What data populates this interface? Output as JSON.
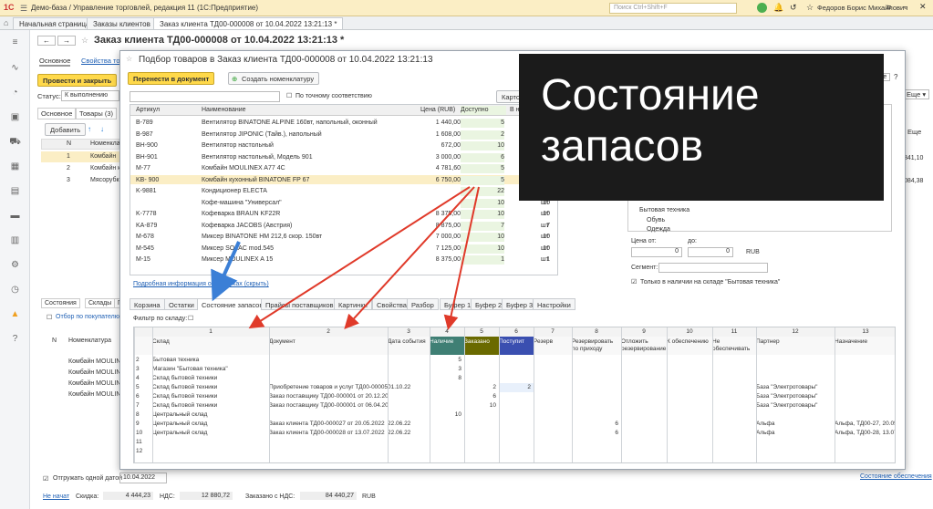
{
  "app": {
    "title": "Демо-база / Управление торговлей, редакция 11  (1С:Предприятие)",
    "search_placeholder": "Поиск Ctrl+Shift+F",
    "user": "Федоров Борис Михайлович"
  },
  "tabs": [
    "Начальная страница",
    "Заказы клиентов",
    "Заказ клиента ТД00-000008 от 10.04.2022 13:21:13 *"
  ],
  "doc": {
    "title": "Заказ клиента ТД00-000008 от 10.04.2022 13:21:13 *",
    "tab_main": "Основное",
    "tab_props": "Свойства товара",
    "post_close": "Провести и закрыть",
    "status_label": "Статус:",
    "status_value": "К выполнению",
    "sub_main": "Основное",
    "sub_goods": "Товары (3)",
    "add": "Добавить",
    "col_n": "N",
    "col_nom": "Номенклат",
    "rows": [
      {
        "n": "1",
        "name": "Комбайн"
      },
      {
        "n": "2",
        "name": "Комбайн к"
      },
      {
        "n": "3",
        "name": "Мясорубка"
      }
    ],
    "right_vals": [
      "341,10",
      "084,38"
    ],
    "right_more": "Еще",
    "btm_tabs": [
      "Состояния",
      "Склады",
      "П"
    ],
    "selection": "Отбор по покупателю",
    "btm_cols": [
      "N",
      "Номенклатура"
    ],
    "btm_rows": [
      "Комбайн MOULINE",
      "Комбайн MOULINE",
      "Комбайн MOULINE",
      "Комбайн MOULINE"
    ],
    "ship_one": "Отгружать одной датой",
    "ship_date": "10.04.2022",
    "state_link": "Состояние обеспечения",
    "not_started": "Не начат",
    "discount_lbl": "Скидка:",
    "discount": "4 444,23",
    "vat_lbl": "НДС:",
    "vat": "12 880,72",
    "ordered_lbl": "Заказано с НДС:",
    "ordered": "84 440,27",
    "currency": "RUB"
  },
  "dialog": {
    "title": "Подбор товаров в Заказ клиента ТД00-000008 от 10.04.2022 13:21:13",
    "move_btn": "Перенести в документ",
    "create_btn": "Создать номенклатуру",
    "exact": "По точному соответствию",
    "card_btn": "Карточка товара",
    "more": "Еще",
    "headers": [
      "Артикул",
      "Наименование",
      "Цена (RUB)",
      "Доступно",
      "В наличии"
    ],
    "rows": [
      {
        "art": "B-789",
        "name": "Вентилятор BINATONE ALPINE 160вт, напольный, оконный",
        "price": "1 440,00",
        "avail": "5",
        "stock": "5",
        "unit": "шт"
      },
      {
        "art": "B-987",
        "name": "Вентилятор JIPONIC (Тайв.), напольный",
        "price": "1 608,00",
        "avail": "2",
        "stock": "2",
        "unit": "шт"
      },
      {
        "art": "BH-900",
        "name": "Вентилятор настольный",
        "price": "672,00",
        "avail": "10",
        "stock": "10",
        "unit": "шт"
      },
      {
        "art": "BH-901",
        "name": "Вентилятор настольный, Модель 901",
        "price": "3 000,00",
        "avail": "6",
        "stock": "6",
        "unit": "шт"
      },
      {
        "art": "M-77",
        "name": "Комбайн MOULINEX A77 4C",
        "price": "4 781,60",
        "avail": "5",
        "stock": "5",
        "unit": "шт"
      },
      {
        "art": "KB- 900",
        "name": "Комбайн кухонный BINATONE FP 67",
        "price": "6 750,00",
        "avail": "5",
        "stock": "5",
        "unit": "шт"
      },
      {
        "art": "K-9881",
        "name": "Кондиционер ELECTA",
        "price": "",
        "avail": "22",
        "stock": "22",
        "unit": "шт"
      },
      {
        "art": "",
        "name": "Кофе-машина \"Универсал\"",
        "price": "",
        "avail": "10",
        "stock": "10",
        "unit": "шт"
      },
      {
        "art": "K-7778",
        "name": "Кофеварка BRAUN KF22R",
        "price": "8 375,00",
        "avail": "10",
        "stock": "10",
        "unit": "шт"
      },
      {
        "art": "KA-879",
        "name": "Кофеварка JACOBS (Австрия)",
        "price": "8 875,00",
        "avail": "7",
        "stock": "7",
        "unit": "шт"
      },
      {
        "art": "M-678",
        "name": "Миксер BINATONE HM 212,6 скор. 150вт",
        "price": "7 000,00",
        "avail": "10",
        "stock": "10",
        "unit": "шт"
      },
      {
        "art": "M-545",
        "name": "Миксер SOLAC mod.545",
        "price": "7 125,00",
        "avail": "10",
        "stock": "10",
        "unit": "шт"
      },
      {
        "art": "M-15",
        "name": "Миксер MOULINEX A 15",
        "price": "8 375,00",
        "avail": "1",
        "stock": "1",
        "unit": "шт"
      }
    ],
    "detail_link": "Подробная информация об остатках (скрыть)",
    "right_tree": [
      "Бытовая техника",
      "Обувь",
      "Одежда"
    ],
    "price_from": "Цена от:",
    "price_to": "до:",
    "zero": "0",
    "rub": "RUB",
    "segment": "Сегмент:",
    "in_stock_only": "Только в наличии на складе \"Бытовая техника\"",
    "tabs": [
      "Корзина",
      "Остатки",
      "Состояние запасов",
      "Прайсы поставщиков",
      "Картинки",
      "Свойства",
      "Разбор",
      "Буфер 1",
      "Буфер 2",
      "Буфер 3",
      "Настройки"
    ],
    "filter_wh": "Фильтр по складу:",
    "grid_nums": [
      "1",
      "2",
      "3",
      "4",
      "5",
      "6",
      "7",
      "8",
      "9",
      "10",
      "11",
      "12",
      "13"
    ],
    "grid_heads": [
      "Склад",
      "Документ",
      "Дата события",
      "Наличие",
      "Заказано",
      "Поступит",
      "Резерв",
      "Резервировать по приходу",
      "Отложить резервирование",
      "К обеспечению",
      "Не обеспечивать",
      "Партнер",
      "Назначение"
    ],
    "grid_rows": [
      {
        "n": "2",
        "wh": "Бытовая техника",
        "doc": "",
        "date": "",
        "nal": "5",
        "zak": "",
        "pos": "",
        "rez": "",
        "rpp": "",
        "otl": "",
        "part": "",
        "naz": ""
      },
      {
        "n": "3",
        "wh": "Магазин \"Бытовая техника\"",
        "doc": "",
        "date": "",
        "nal": "3",
        "zak": "",
        "pos": "",
        "rez": "",
        "rpp": "",
        "otl": "",
        "part": "",
        "naz": ""
      },
      {
        "n": "4",
        "wh": "Склад бытовой техники",
        "doc": "",
        "date": "",
        "nal": "8",
        "zak": "",
        "pos": "",
        "rez": "",
        "rpp": "",
        "otl": "",
        "part": "",
        "naz": ""
      },
      {
        "n": "5",
        "wh": "Склад бытовой техники",
        "doc": "Приобретение товаров и услуг ТД00-00005",
        "date": "01.10.22",
        "nal": "",
        "zak": "2",
        "pos": "2",
        "rez": "",
        "rpp": "",
        "otl": "",
        "part": "База \"Электротовары\"",
        "naz": ""
      },
      {
        "n": "6",
        "wh": "Склад бытовой техники",
        "doc": "Заказ поставщику ТД00-000001 от 20.12.20",
        "date": "",
        "nal": "",
        "zak": "6",
        "pos": "",
        "rez": "",
        "rpp": "",
        "otl": "",
        "part": "База \"Электротовары\"",
        "naz": ""
      },
      {
        "n": "7",
        "wh": "Склад бытовой техники",
        "doc": "Заказ поставщику ТД00-000001 от 06.04.20",
        "date": "",
        "nal": "",
        "zak": "10",
        "pos": "",
        "rez": "",
        "rpp": "",
        "otl": "",
        "part": "База \"Электротовары\"",
        "naz": ""
      },
      {
        "n": "8",
        "wh": "Центральный склад",
        "doc": "",
        "date": "",
        "nal": "10",
        "zak": "",
        "pos": "",
        "rez": "",
        "rpp": "",
        "otl": "",
        "part": "",
        "naz": ""
      },
      {
        "n": "9",
        "wh": "Центральный склад",
        "doc": "Заказ клиента ТД00-000027 от 20.05.2022",
        "date": "22.06.22",
        "nal": "",
        "zak": "",
        "pos": "",
        "rez": "",
        "rpp": "6",
        "otl": "",
        "part": "Альфа",
        "naz": "Альфа, ТД00-27, 20.05.2"
      },
      {
        "n": "10",
        "wh": "Центральный склад",
        "doc": "Заказ клиента ТД00-000028 от 13.07.2022",
        "date": "22.06.22",
        "nal": "",
        "zak": "",
        "pos": "",
        "rez": "",
        "rpp": "6",
        "otl": "",
        "part": "Альфа",
        "naz": "Альфа, ТД00-28, 13.07.2"
      },
      {
        "n": "11",
        "wh": "",
        "doc": "",
        "date": "",
        "nal": "",
        "zak": "",
        "pos": "",
        "rez": "",
        "rpp": "",
        "otl": "",
        "part": "",
        "naz": ""
      },
      {
        "n": "12",
        "wh": "",
        "doc": "",
        "date": "",
        "nal": "",
        "zak": "",
        "pos": "",
        "rez": "",
        "rpp": "",
        "otl": "",
        "part": "",
        "naz": ""
      }
    ]
  },
  "overlay": {
    "line1": "Состояние",
    "line2": "запасов"
  },
  "colors": {
    "accent_yellow": "#ffd94a",
    "arrow_red": "#e03a2a",
    "arrow_blue": "#3b7fd6",
    "overlay_bg": "#1b1b1b",
    "nal_head": "#3f7f74",
    "zak_head": "#6a6a00",
    "pos_head": "#3a4fb0"
  }
}
